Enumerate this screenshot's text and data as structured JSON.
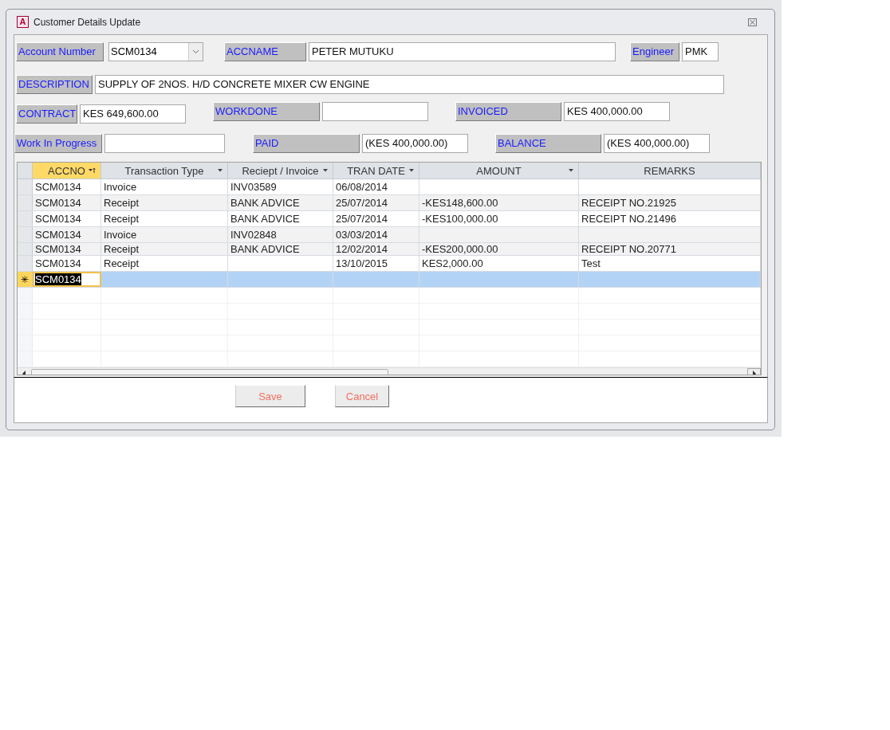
{
  "window": {
    "title": "Customer Details Update",
    "icon_letter": "A"
  },
  "header": {
    "account_number": {
      "label": "Account Number",
      "value": "SCM0134"
    },
    "accname": {
      "label": "ACCNAME",
      "value": "PETER MUTUKU"
    },
    "engineer": {
      "label": "Engineer",
      "value": "PMK"
    },
    "description": {
      "label": "DESCRIPTION",
      "value": "SUPPLY OF 2NOS. H/D CONCRETE MIXER CW ENGINE"
    }
  },
  "totals": [
    {
      "label": "CONTRACT",
      "value": "KES  649,600.00"
    },
    {
      "label": "WORKDONE"
    },
    {
      "label": "INVOICED",
      "value": "KES  400,000.00"
    },
    {
      "label": "Work In Progress"
    },
    {
      "label": "PAID",
      "value": "(KES  400,000.00)"
    },
    {
      "label": "BALANCE",
      "value": "(KES  400,000.00)"
    }
  ],
  "grid": {
    "columns": [
      {
        "label": "ACCNO",
        "kind": "sorted",
        "selected": true
      },
      {
        "label": "Transaction Type",
        "kind": "filter",
        "selected": false
      },
      {
        "label": "Reciept / Invoice",
        "kind": "filter",
        "selected": false
      },
      {
        "label": "TRAN DATE",
        "kind": "filter",
        "selected": false
      },
      {
        "label": "AMOUNT",
        "kind": "filter",
        "selected": false
      },
      {
        "label": "REMARKS",
        "kind": "plain",
        "selected": false
      }
    ],
    "rows": [
      {
        "kind": "data",
        "selected": false,
        "shaded": false,
        "cells": [
          "SCM0134",
          "Invoice",
          "INV03589",
          "06/08/2014",
          "",
          ""
        ]
      },
      {
        "kind": "data",
        "selected": false,
        "shaded": true,
        "cells": [
          "SCM0134",
          "Receipt",
          "BANK ADVICE",
          "25/07/2014",
          "-KES148,600.00",
          "RECEIPT NO.21925"
        ]
      },
      {
        "kind": "data",
        "selected": false,
        "shaded": false,
        "cells": [
          "SCM0134",
          "Receipt",
          "BANK ADVICE",
          "25/07/2014",
          "-KES100,000.00",
          "RECEIPT NO.21496"
        ]
      },
      {
        "kind": "data",
        "selected": false,
        "shaded": true,
        "cells": [
          "SCM0134",
          "Invoice",
          "INV02848",
          "03/03/2014",
          "",
          ""
        ]
      },
      {
        "kind": "data",
        "selected": false,
        "shaded": true,
        "cells": [
          "SCM0134",
          "Receipt",
          "BANK ADVICE",
          "12/02/2014",
          "-KES200,000.00",
          "RECEIPT NO.20771"
        ]
      },
      {
        "kind": "data",
        "selected": false,
        "shaded": false,
        "cells": [
          "SCM0134",
          "Receipt",
          "",
          "13/10/2015",
          "KES2,000.00",
          "Test"
        ]
      },
      {
        "kind": "new",
        "selected": true,
        "shaded": false,
        "marker": "✳",
        "cells": [
          "SCM0134",
          "",
          "",
          "",
          "",
          ""
        ]
      }
    ]
  },
  "buttons": [
    {
      "label": "Save"
    },
    {
      "label": "Cancel"
    }
  ]
}
